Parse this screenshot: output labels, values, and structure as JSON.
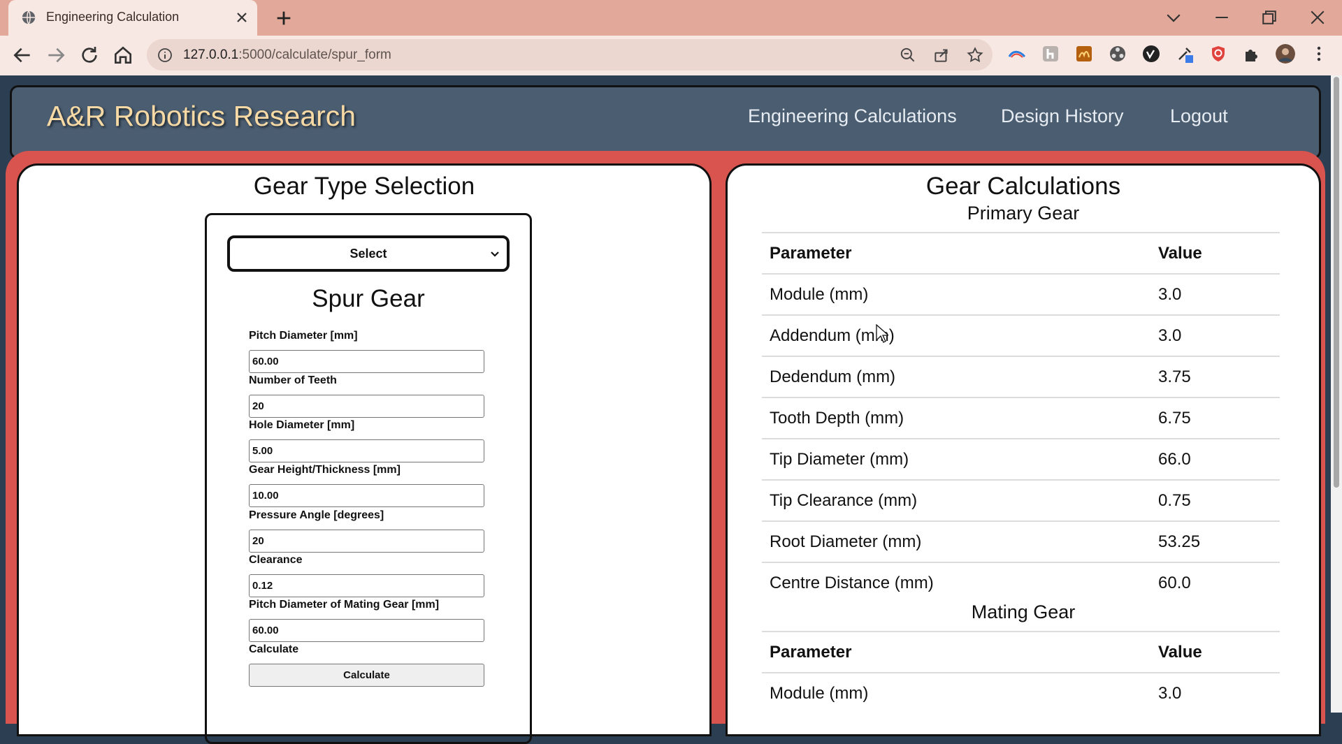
{
  "browser": {
    "tab_title": "Engineering Calculation",
    "url_host": "127.0.0.1",
    "url_path": ":5000/calculate/spur_form"
  },
  "site": {
    "brand": "A&R Robotics Research",
    "nav": [
      "Engineering Calculations",
      "Design History",
      "Logout"
    ]
  },
  "left_card": {
    "title": "Gear Type Selection",
    "select_value": "Select",
    "form_title": "Spur Gear",
    "fields": [
      {
        "label": "Pitch Diameter [mm]",
        "value": "60.00"
      },
      {
        "label": "Number of Teeth",
        "value": "20"
      },
      {
        "label": "Hole Diameter [mm]",
        "value": "5.00"
      },
      {
        "label": "Gear Height/Thickness [mm]",
        "value": "10.00"
      },
      {
        "label": "Pressure Angle [degrees]",
        "value": "20"
      },
      {
        "label": "Clearance",
        "value": "0.12"
      },
      {
        "label": "Pitch Diameter of Mating Gear [mm]",
        "value": "60.00"
      }
    ],
    "calculate_label": "Calculate",
    "calculate_button": "Calculate"
  },
  "right_card": {
    "title": "Gear Calculations",
    "primary": {
      "heading": "Primary Gear",
      "col_param": "Parameter",
      "col_value": "Value",
      "rows": [
        {
          "param": "Module (mm)",
          "value": "3.0"
        },
        {
          "param": "Addendum (mm)",
          "value": "3.0"
        },
        {
          "param": "Dedendum (mm)",
          "value": "3.75"
        },
        {
          "param": "Tooth Depth (mm)",
          "value": "6.75"
        },
        {
          "param": "Tip Diameter (mm)",
          "value": "66.0"
        },
        {
          "param": "Tip Clearance (mm)",
          "value": "0.75"
        },
        {
          "param": "Root Diameter (mm)",
          "value": "53.25"
        },
        {
          "param": "Centre Distance (mm)",
          "value": "60.0"
        }
      ]
    },
    "mating": {
      "heading": "Mating Gear",
      "col_param": "Parameter",
      "col_value": "Value",
      "rows": [
        {
          "param": "Module (mm)",
          "value": "3.0"
        }
      ]
    }
  }
}
